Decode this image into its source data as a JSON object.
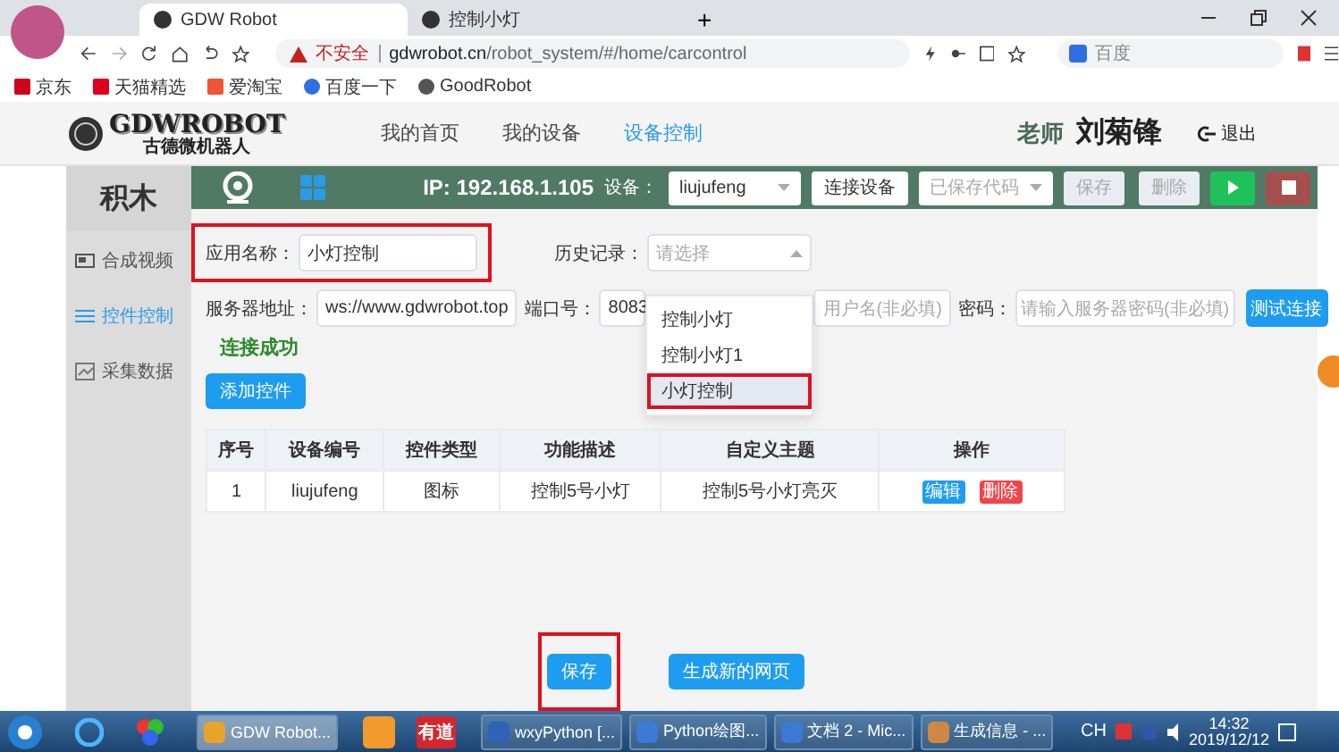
{
  "browser": {
    "tabs": [
      {
        "title": "GDW Robot",
        "selected": true
      },
      {
        "title": "控制小灯",
        "selected": false
      }
    ],
    "new_tab": "+",
    "security": "不安全",
    "url_host": "gdwrobot.cn",
    "url_path": "/robot_system/#/home/carcontrol",
    "search_placeholder": "百度",
    "bookmarks": [
      "京东",
      "天猫精选",
      "爱淘宝",
      "百度一下",
      "GoodRobot"
    ]
  },
  "header": {
    "logo": "GDWROBOT",
    "logo_sub": "古德微机器人",
    "nav": [
      {
        "label": "我的首页",
        "selected": false
      },
      {
        "label": "我的设备",
        "selected": false
      },
      {
        "label": "设备控制",
        "selected": true
      }
    ],
    "role": "老师",
    "user": "刘菊锋",
    "logout": "退出"
  },
  "sidebar": {
    "title": "积木",
    "items": [
      {
        "label": "合成视频",
        "selected": false
      },
      {
        "label": "控件控制",
        "selected": true
      },
      {
        "label": "采集数据",
        "selected": false
      }
    ]
  },
  "toolbar": {
    "ip": "IP: 192.168.1.105",
    "device_label": "设备：",
    "device": "liujufeng",
    "connect": "连接设备",
    "saved_code": "已保存代码",
    "save": {
      "label": "保存",
      "disabled": true
    },
    "delete": {
      "label": "删除",
      "disabled": true
    }
  },
  "form": {
    "app_name_label": "应用名称：",
    "app_name": "小灯控制",
    "app_name_highlighted": true,
    "history_label": "历史记录：",
    "history_placeholder": "请选择",
    "history_options": [
      {
        "label": "控制小灯",
        "selected": false,
        "highlighted": false
      },
      {
        "label": "控制小灯1",
        "selected": false,
        "highlighted": false
      },
      {
        "label": "小灯控制",
        "selected": true,
        "highlighted": true
      }
    ],
    "server_label": "服务器地址：",
    "server": "ws://www.gdwrobot.top",
    "port_label": "端口号：",
    "port": "8083",
    "username_placeholder": "用户名(非必填)",
    "password_label": "密码：",
    "password_placeholder": "请输入服务器密码(非必填)",
    "test_button": "测试连接",
    "status": "连接成功",
    "add_button": "添加控件"
  },
  "table": {
    "columns": [
      "序号",
      "设备编号",
      "控件类型",
      "功能描述",
      "自定义主题",
      "操作"
    ],
    "rows": [
      {
        "cells": [
          "1",
          "liujufeng",
          "图标",
          "控制5号小灯",
          "控制5号小灯亮灭"
        ],
        "actions": [
          {
            "label": "编辑",
            "kind": "edit"
          },
          {
            "label": "删除",
            "kind": "delete"
          }
        ]
      }
    ]
  },
  "footer_buttons": [
    {
      "label": "保存",
      "highlighted": true
    },
    {
      "label": "生成新的网页",
      "highlighted": false
    }
  ],
  "taskbar": {
    "items": [
      {
        "label": "GDW Robot...",
        "selected": true
      },
      {
        "label": "wxyPython [...",
        "selected": false
      },
      {
        "label": "Python绘图...",
        "selected": false
      },
      {
        "label": "文档 2 - Mic...",
        "selected": false
      },
      {
        "label": "生成信息 - ...",
        "selected": false
      }
    ],
    "youdao": "有道",
    "ime": "CH",
    "time": "14:32",
    "date": "2019/12/12"
  }
}
